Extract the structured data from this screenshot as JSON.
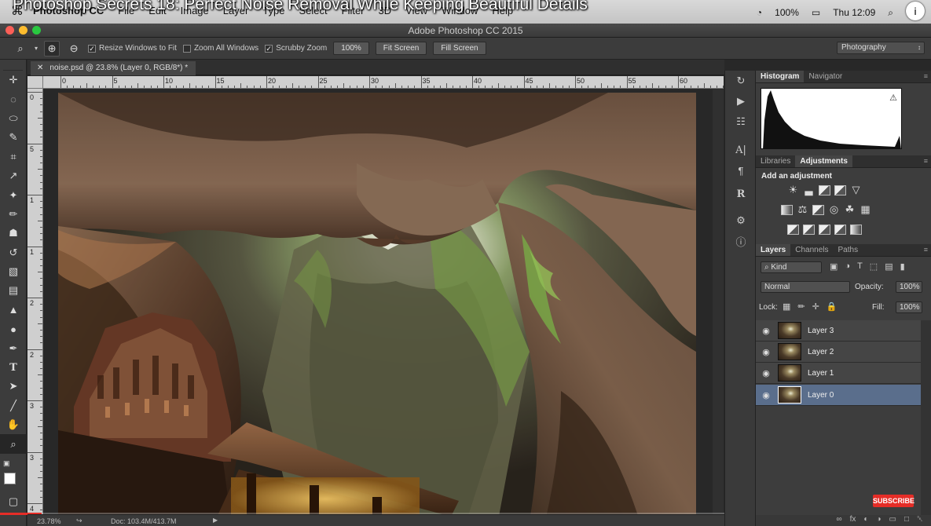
{
  "menubar": {
    "apple": "",
    "menus": [
      "Photoshop CC",
      "File",
      "Edit",
      "Image",
      "Layer",
      "Type",
      "Select",
      "Filter",
      "3D",
      "View",
      "Window",
      "Help"
    ],
    "video_title": "Photoshop Secrets 18: Perfect Noise Removal While Keeping Beautiful Details",
    "battery": "100%",
    "clock": "Thu 12:09"
  },
  "window": {
    "title": "Adobe Photoshop CC 2015"
  },
  "options": {
    "resize_windows": "Resize Windows to Fit",
    "zoom_all": "Zoom All Windows",
    "scrubby_zoom": "Scrubby Zoom",
    "zoom_value": "100%",
    "fit_screen": "Fit Screen",
    "fill_screen": "Fill Screen",
    "workspace": "Photography"
  },
  "document": {
    "tab_title": "noise.psd @ 23.8% (Layer 0, RGB/8*) *",
    "ruler_h_labels": [
      "0",
      "5",
      "10",
      "15",
      "20",
      "25",
      "30",
      "35",
      "40",
      "45",
      "50",
      "55",
      "60"
    ],
    "ruler_v_labels": [
      "0",
      "5",
      "1",
      "1",
      "2",
      "2",
      "3",
      "3",
      "4"
    ],
    "zoom_status": "23.78%",
    "doc_status": "Doc: 103.4M/413.7M"
  },
  "video": {
    "progress": 0.045,
    "subscribe": "SUBSCRIBE"
  },
  "panels": {
    "top_tabs": [
      "Histogram",
      "Navigator"
    ],
    "mid_tabs": [
      "Libraries",
      "Adjustments"
    ],
    "add_adjustment": "Add an adjustment",
    "layer_tabs": [
      "Layers",
      "Channels",
      "Paths"
    ],
    "kind_filter": "Kind",
    "blend_mode": "Normal",
    "opacity_label": "Opacity:",
    "opacity_value": "100%",
    "lock_label": "Lock:",
    "fill_label": "Fill:",
    "fill_value": "100%",
    "layers": [
      {
        "name": "Layer 3",
        "selected": false
      },
      {
        "name": "Layer 2",
        "selected": false
      },
      {
        "name": "Layer 1",
        "selected": false
      },
      {
        "name": "Layer 0",
        "selected": true
      }
    ]
  },
  "colors": {
    "accent": "#5a6e8c",
    "subscribe": "#e52d27",
    "progress": "#e52d27"
  }
}
